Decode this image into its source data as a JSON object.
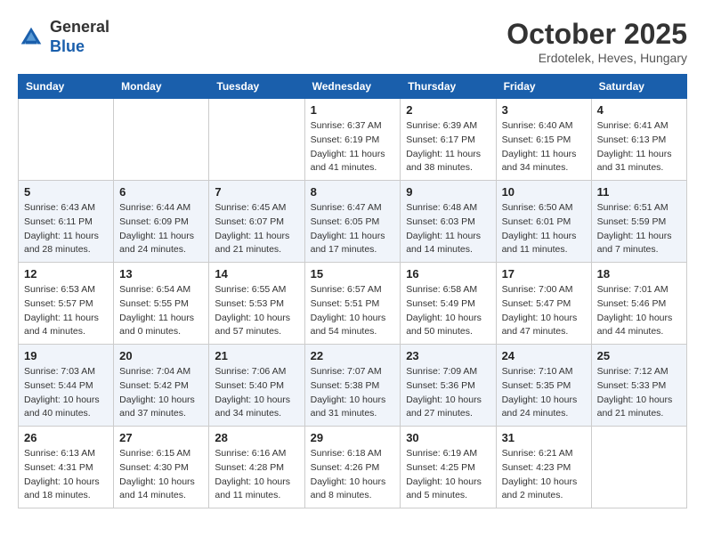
{
  "logo": {
    "general": "General",
    "blue": "Blue"
  },
  "header": {
    "month": "October 2025",
    "location": "Erdotelek, Heves, Hungary"
  },
  "days_of_week": [
    "Sunday",
    "Monday",
    "Tuesday",
    "Wednesday",
    "Thursday",
    "Friday",
    "Saturday"
  ],
  "weeks": [
    [
      {
        "day": "",
        "sunrise": "",
        "sunset": "",
        "daylight": ""
      },
      {
        "day": "",
        "sunrise": "",
        "sunset": "",
        "daylight": ""
      },
      {
        "day": "",
        "sunrise": "",
        "sunset": "",
        "daylight": ""
      },
      {
        "day": "1",
        "sunrise": "Sunrise: 6:37 AM",
        "sunset": "Sunset: 6:19 PM",
        "daylight": "Daylight: 11 hours and 41 minutes."
      },
      {
        "day": "2",
        "sunrise": "Sunrise: 6:39 AM",
        "sunset": "Sunset: 6:17 PM",
        "daylight": "Daylight: 11 hours and 38 minutes."
      },
      {
        "day": "3",
        "sunrise": "Sunrise: 6:40 AM",
        "sunset": "Sunset: 6:15 PM",
        "daylight": "Daylight: 11 hours and 34 minutes."
      },
      {
        "day": "4",
        "sunrise": "Sunrise: 6:41 AM",
        "sunset": "Sunset: 6:13 PM",
        "daylight": "Daylight: 11 hours and 31 minutes."
      }
    ],
    [
      {
        "day": "5",
        "sunrise": "Sunrise: 6:43 AM",
        "sunset": "Sunset: 6:11 PM",
        "daylight": "Daylight: 11 hours and 28 minutes."
      },
      {
        "day": "6",
        "sunrise": "Sunrise: 6:44 AM",
        "sunset": "Sunset: 6:09 PM",
        "daylight": "Daylight: 11 hours and 24 minutes."
      },
      {
        "day": "7",
        "sunrise": "Sunrise: 6:45 AM",
        "sunset": "Sunset: 6:07 PM",
        "daylight": "Daylight: 11 hours and 21 minutes."
      },
      {
        "day": "8",
        "sunrise": "Sunrise: 6:47 AM",
        "sunset": "Sunset: 6:05 PM",
        "daylight": "Daylight: 11 hours and 17 minutes."
      },
      {
        "day": "9",
        "sunrise": "Sunrise: 6:48 AM",
        "sunset": "Sunset: 6:03 PM",
        "daylight": "Daylight: 11 hours and 14 minutes."
      },
      {
        "day": "10",
        "sunrise": "Sunrise: 6:50 AM",
        "sunset": "Sunset: 6:01 PM",
        "daylight": "Daylight: 11 hours and 11 minutes."
      },
      {
        "day": "11",
        "sunrise": "Sunrise: 6:51 AM",
        "sunset": "Sunset: 5:59 PM",
        "daylight": "Daylight: 11 hours and 7 minutes."
      }
    ],
    [
      {
        "day": "12",
        "sunrise": "Sunrise: 6:53 AM",
        "sunset": "Sunset: 5:57 PM",
        "daylight": "Daylight: 11 hours and 4 minutes."
      },
      {
        "day": "13",
        "sunrise": "Sunrise: 6:54 AM",
        "sunset": "Sunset: 5:55 PM",
        "daylight": "Daylight: 11 hours and 0 minutes."
      },
      {
        "day": "14",
        "sunrise": "Sunrise: 6:55 AM",
        "sunset": "Sunset: 5:53 PM",
        "daylight": "Daylight: 10 hours and 57 minutes."
      },
      {
        "day": "15",
        "sunrise": "Sunrise: 6:57 AM",
        "sunset": "Sunset: 5:51 PM",
        "daylight": "Daylight: 10 hours and 54 minutes."
      },
      {
        "day": "16",
        "sunrise": "Sunrise: 6:58 AM",
        "sunset": "Sunset: 5:49 PM",
        "daylight": "Daylight: 10 hours and 50 minutes."
      },
      {
        "day": "17",
        "sunrise": "Sunrise: 7:00 AM",
        "sunset": "Sunset: 5:47 PM",
        "daylight": "Daylight: 10 hours and 47 minutes."
      },
      {
        "day": "18",
        "sunrise": "Sunrise: 7:01 AM",
        "sunset": "Sunset: 5:46 PM",
        "daylight": "Daylight: 10 hours and 44 minutes."
      }
    ],
    [
      {
        "day": "19",
        "sunrise": "Sunrise: 7:03 AM",
        "sunset": "Sunset: 5:44 PM",
        "daylight": "Daylight: 10 hours and 40 minutes."
      },
      {
        "day": "20",
        "sunrise": "Sunrise: 7:04 AM",
        "sunset": "Sunset: 5:42 PM",
        "daylight": "Daylight: 10 hours and 37 minutes."
      },
      {
        "day": "21",
        "sunrise": "Sunrise: 7:06 AM",
        "sunset": "Sunset: 5:40 PM",
        "daylight": "Daylight: 10 hours and 34 minutes."
      },
      {
        "day": "22",
        "sunrise": "Sunrise: 7:07 AM",
        "sunset": "Sunset: 5:38 PM",
        "daylight": "Daylight: 10 hours and 31 minutes."
      },
      {
        "day": "23",
        "sunrise": "Sunrise: 7:09 AM",
        "sunset": "Sunset: 5:36 PM",
        "daylight": "Daylight: 10 hours and 27 minutes."
      },
      {
        "day": "24",
        "sunrise": "Sunrise: 7:10 AM",
        "sunset": "Sunset: 5:35 PM",
        "daylight": "Daylight: 10 hours and 24 minutes."
      },
      {
        "day": "25",
        "sunrise": "Sunrise: 7:12 AM",
        "sunset": "Sunset: 5:33 PM",
        "daylight": "Daylight: 10 hours and 21 minutes."
      }
    ],
    [
      {
        "day": "26",
        "sunrise": "Sunrise: 6:13 AM",
        "sunset": "Sunset: 4:31 PM",
        "daylight": "Daylight: 10 hours and 18 minutes."
      },
      {
        "day": "27",
        "sunrise": "Sunrise: 6:15 AM",
        "sunset": "Sunset: 4:30 PM",
        "daylight": "Daylight: 10 hours and 14 minutes."
      },
      {
        "day": "28",
        "sunrise": "Sunrise: 6:16 AM",
        "sunset": "Sunset: 4:28 PM",
        "daylight": "Daylight: 10 hours and 11 minutes."
      },
      {
        "day": "29",
        "sunrise": "Sunrise: 6:18 AM",
        "sunset": "Sunset: 4:26 PM",
        "daylight": "Daylight: 10 hours and 8 minutes."
      },
      {
        "day": "30",
        "sunrise": "Sunrise: 6:19 AM",
        "sunset": "Sunset: 4:25 PM",
        "daylight": "Daylight: 10 hours and 5 minutes."
      },
      {
        "day": "31",
        "sunrise": "Sunrise: 6:21 AM",
        "sunset": "Sunset: 4:23 PM",
        "daylight": "Daylight: 10 hours and 2 minutes."
      },
      {
        "day": "",
        "sunrise": "",
        "sunset": "",
        "daylight": ""
      }
    ]
  ]
}
